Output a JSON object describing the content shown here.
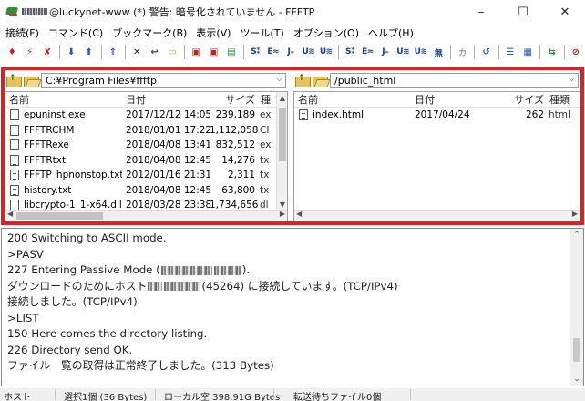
{
  "titlebar": {
    "title": "@luckynet-www (*) 警告: 暗号化されていません - FFFTP",
    "minimize": "–",
    "maximize": "☐",
    "close": "✕"
  },
  "menu": [
    "接続(F)",
    "コマンド(C)",
    "ブックマーク(B)",
    "表示(V)",
    "ツール(T)",
    "オプション(O)",
    "ヘルプ(H)"
  ],
  "toolbar": {
    "buttons": [
      "S⁑",
      "E≈",
      "J₌",
      "U≋",
      "U≋",
      "S⁑",
      "E≈",
      "J₌",
      "U≋",
      "U≋",
      "無",
      "カ",
      "↺"
    ]
  },
  "local": {
    "path": "C:¥Program Files¥ffftp",
    "columns": [
      "名前",
      "日付",
      "サイズ",
      "種 ^"
    ],
    "files": [
      {
        "name": "epuninst.exe",
        "date": "2017/12/12 14:05",
        "size": "239,189",
        "type": "ex"
      },
      {
        "name": "FFFTRCHM",
        "date": "2018/01/01 17:22",
        "size": "1,112,058",
        "type": "CI"
      },
      {
        "name": "FFFTRexe",
        "date": "2018/04/08 13:41",
        "size": "832,512",
        "type": "ex"
      },
      {
        "name": "FFFTRtxt",
        "date": "2018/04/08 12:45",
        "size": "14,276",
        "type": "tx"
      },
      {
        "name": "FFFTP_hpnonstop.txt",
        "date": "2012/01/16 21:31",
        "size": "2,311",
        "type": "tx"
      },
      {
        "name": "history.txt",
        "date": "2018/04/08 12:45",
        "size": "63,800",
        "type": "tx"
      },
      {
        "name": "libcrypto-1_1-x64.dll",
        "date": "2018/03/28 23:38",
        "size": "1,734,656",
        "type": "dl"
      }
    ]
  },
  "remote": {
    "path": "/public_html",
    "columns": [
      "名前",
      "日付",
      "サイズ",
      "種類"
    ],
    "files": [
      {
        "name": "index.html",
        "date": "2017/04/24",
        "size": "262",
        "type": "html"
      }
    ]
  },
  "log": {
    "lines": [
      "200 Switching to ASCII mode.",
      ">PASV",
      "227 Entering Passive Mode (",
      "ダウンロードのためにホスト",
      "(45264) に接続しています。(TCP/IPv4)",
      "接続しました。(TCP/IPv4)",
      ">LIST",
      "150 Here comes the directory listing.",
      "226 Directory send OK.",
      "ファイル一覧の取得は正常終了しました。(313 Bytes)"
    ]
  },
  "status": {
    "host": "ホスト",
    "selection": "選択1個 (36 Bytes)",
    "local_free": "ローカル空 398.91G Bytes",
    "queue": "転送待ちファイル0個"
  }
}
